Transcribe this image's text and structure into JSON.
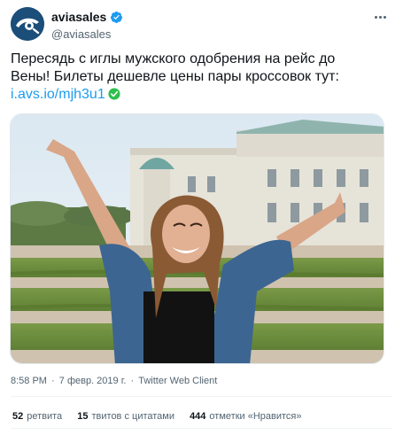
{
  "account": {
    "display_name": "aviasales",
    "handle": "@aviasales",
    "icons": {
      "avatar": "aviasales-logo",
      "verified": "verified-badge-icon",
      "more": "more-options-icon"
    }
  },
  "tweet": {
    "text_line1": "Пересядь с иглы мужского одобрения на рейс до",
    "text_line2": "Вены! Билеты дешевле цены пары кроссовок тут:",
    "link": "i.avs.io/mjh3u1",
    "link_icon": "check-circle-icon"
  },
  "media": {
    "type": "photo",
    "subject": "woman-raising-arms-in-front-of-palace"
  },
  "meta": {
    "time": "8:58 PM",
    "date": "7 февр. 2019 г.",
    "separator": "·",
    "client": "Twitter Web Client"
  },
  "stats": {
    "retweets_count": "52",
    "retweets_label": "ретвита",
    "quotes_count": "15",
    "quotes_label": "твитов с цитатами",
    "likes_count": "444",
    "likes_label": "отметки «Нравится»"
  },
  "colors": {
    "link": "#1d9bf0",
    "text": "#0f1419",
    "secondary": "#536471",
    "avatar_bg": "#1b4e79",
    "check_green": "#2dbf4e"
  }
}
